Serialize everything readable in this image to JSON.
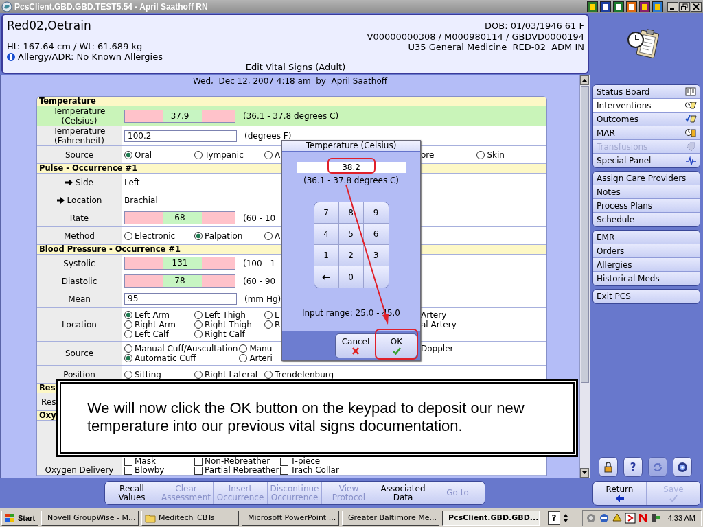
{
  "window": {
    "title": "PcsClient.GBD.GBD.TEST5.54 - April Saathoff RN"
  },
  "patient": {
    "name": "Red02,Oetrain",
    "dob": "DOB: 01/03/1946 61 F",
    "ids": "V00000000308 / M000980114 / GBDVD0000194",
    "location": "U35 General Medicine  RED-02  ADM IN",
    "measures": "Ht: 167.64 cm / Wt: 61.689 kg",
    "allergy": "Allergy/ADR: No Known Allergies",
    "screen_title": "Edit Vital Signs (Adult)"
  },
  "form": {
    "timestamp": "Wed,  Dec 12, 2007 4:18 am  by  April Saathoff",
    "sections": [
      {
        "title": "Temperature",
        "rows": [
          {
            "kind": "range",
            "label": "Temperature (Celsius)",
            "value": "37.9",
            "note": "(36.1 - 37.8 degrees C)",
            "highlighted": true
          },
          {
            "kind": "input",
            "label": "Temperature (Fahrenheit)",
            "value": "100.2",
            "note": "(degrees F)",
            "highlighted": false
          },
          {
            "kind": "choices",
            "label": "Source",
            "highlighted": false,
            "columns": [
              [
                {
                  "kind": "radio",
                  "label": "Oral",
                  "selected": true
                }
              ],
              [
                {
                  "kind": "radio",
                  "label": "Tympanic",
                  "selected": false
                }
              ],
              [
                {
                  "kind": "radio",
                  "label": "A",
                  "selected": false
                }
              ]
            ],
            "after": [
              [
                {
                  "kind": "fragment",
                  "label": "ore"
                },
                {
                  "kind": "radio",
                  "label": "Skin",
                  "selected": false
                }
              ]
            ]
          }
        ]
      },
      {
        "title": "Pulse - Occurrence #1",
        "rows": [
          {
            "kind": "detail",
            "label": "Side",
            "value": "Left",
            "highlighted": false
          },
          {
            "kind": "detail",
            "label": "Location",
            "value": "Brachial",
            "highlighted": false
          },
          {
            "kind": "range",
            "label": "Rate",
            "value": "68",
            "note": "(60 - 10",
            "highlighted": false
          },
          {
            "kind": "choices",
            "label": "Method",
            "highlighted": false,
            "columns": [
              [
                {
                  "kind": "radio",
                  "label": "Electronic",
                  "selected": false
                }
              ],
              [
                {
                  "kind": "radio",
                  "label": "Palpation",
                  "selected": true
                }
              ],
              [
                {
                  "kind": "radio",
                  "label": "A",
                  "selected": false
                }
              ]
            ]
          }
        ]
      },
      {
        "title": "Blood Pressure - Occurrence #1",
        "rows": [
          {
            "kind": "range",
            "label": "Systolic",
            "value": "131",
            "note": "(100 - 1",
            "highlighted": false
          },
          {
            "kind": "range",
            "label": "Diastolic",
            "value": "78",
            "note": "(60 - 90",
            "highlighted": false
          },
          {
            "kind": "input",
            "label": "Mean",
            "value": "95",
            "note": "(mm Hg)",
            "highlighted": false
          },
          {
            "kind": "choices",
            "label": "Location",
            "highlighted": false,
            "columns": [
              [
                {
                  "kind": "radio",
                  "label": "Left Arm",
                  "selected": true
                },
                {
                  "kind": "radio",
                  "label": "Right Arm",
                  "selected": false
                },
                {
                  "kind": "radio",
                  "label": "Left Calf",
                  "selected": false
                }
              ],
              [
                {
                  "kind": "radio",
                  "label": "Left Thigh",
                  "selected": false
                },
                {
                  "kind": "radio",
                  "label": "Right Thigh",
                  "selected": false
                },
                {
                  "kind": "radio",
                  "label": "Right Calf",
                  "selected": false
                }
              ],
              [
                {
                  "kind": "radio",
                  "label": "L",
                  "selected": false
                },
                {
                  "kind": "radio",
                  "label": "R",
                  "selected": false
                }
              ]
            ],
            "after": [
              [
                {
                  "kind": "fragment",
                  "label": "Artery"
                }
              ],
              [
                {
                  "kind": "fragment",
                  "label": "al Artery"
                }
              ]
            ]
          },
          {
            "kind": "choices",
            "label": "Source",
            "highlighted": false,
            "columns": [
              [
                {
                  "kind": "radio",
                  "label": "Manual Cuff/Auscultation",
                  "selected": false
                },
                {
                  "kind": "radio",
                  "label": "Automatic Cuff",
                  "selected": true
                }
              ],
              [
                {
                  "kind": "radio",
                  "label": "Manu",
                  "selected": false
                },
                {
                  "kind": "radio",
                  "label": "Arteri",
                  "selected": false
                }
              ]
            ],
            "after": [
              [
                {
                  "kind": "fragment",
                  "label": "Doppler"
                }
              ]
            ]
          },
          {
            "kind": "choices",
            "label": "Position",
            "highlighted": false,
            "columns": [
              [
                {
                  "kind": "radio",
                  "label": "Sitting",
                  "selected": false
                }
              ],
              [
                {
                  "kind": "radio",
                  "label": "Right Lateral",
                  "selected": false
                }
              ],
              [
                {
                  "kind": "radio",
                  "label": "Trendelenburg",
                  "selected": false
                }
              ]
            ]
          }
        ]
      },
      {
        "title": "Res",
        "rows": [
          {
            "kind": "blank",
            "label": "Res",
            "highlighted": false
          }
        ]
      },
      {
        "title": "Oxy",
        "rows": [
          {
            "kind": "checks",
            "label": "Oxygen Delivery",
            "highlighted": false,
            "columns": [
              [
                {
                  "kind": "check",
                  "label": "Mask",
                  "selected": false
                },
                {
                  "kind": "check",
                  "label": "Blowby",
                  "selected": false
                }
              ],
              [
                {
                  "kind": "check",
                  "label": "Non-Rebreather",
                  "selected": false
                },
                {
                  "kind": "check",
                  "label": "Partial Rebreather",
                  "selected": false
                }
              ],
              [
                {
                  "kind": "check",
                  "label": "T-piece",
                  "selected": false
                },
                {
                  "kind": "check",
                  "label": "Trach Collar",
                  "selected": false
                }
              ]
            ]
          }
        ]
      }
    ]
  },
  "keypad_dialog": {
    "title": "Temperature (Celsius)",
    "value": "38.2",
    "range": "(36.1 - 37.8 degrees C)",
    "keys": [
      "7",
      "8",
      "9",
      "4",
      "5",
      "6",
      "1",
      "2",
      "3",
      "←",
      "0",
      "."
    ],
    "input_range": "Input range: 25.0 - 45.0",
    "buttons": [
      {
        "kind": "cancel",
        "label": "Cancel"
      },
      {
        "kind": "ok",
        "label": "OK"
      }
    ]
  },
  "callout": {
    "text": "We will now click the OK button on the keypad to deposit our new temperature into our previous vital signs documentation."
  },
  "sidebar": {
    "groups": [
      {
        "items": [
          {
            "label": "Status Board",
            "selected": false,
            "disabled": false
          },
          {
            "label": "Interventions",
            "selected": true,
            "disabled": false
          },
          {
            "label": "Outcomes",
            "selected": false,
            "disabled": false
          },
          {
            "label": "MAR",
            "selected": false,
            "disabled": false
          },
          {
            "label": "Transfusions",
            "selected": false,
            "disabled": true
          },
          {
            "label": "Special Panel",
            "selected": false,
            "disabled": false
          }
        ]
      },
      {
        "items": [
          {
            "label": "Assign Care Providers",
            "selected": false,
            "disabled": false
          },
          {
            "label": "Notes",
            "selected": false,
            "disabled": false
          },
          {
            "label": "Process Plans",
            "selected": false,
            "disabled": false
          },
          {
            "label": "Schedule",
            "selected": false,
            "disabled": false
          }
        ]
      },
      {
        "items": [
          {
            "label": "EMR",
            "selected": false,
            "disabled": false
          },
          {
            "label": "Orders",
            "selected": false,
            "disabled": false
          },
          {
            "label": "Allergies",
            "selected": false,
            "disabled": false
          },
          {
            "label": "Historical Meds",
            "selected": false,
            "disabled": false
          }
        ]
      },
      {
        "items": [
          {
            "label": "Exit PCS",
            "selected": false,
            "disabled": false
          }
        ]
      }
    ]
  },
  "tools": [
    {
      "kind": "lock",
      "disabled": false
    },
    {
      "kind": "help",
      "label": "?",
      "disabled": false
    },
    {
      "kind": "refresh",
      "disabled": true
    },
    {
      "kind": "globe",
      "disabled": false
    }
  ],
  "toolbar": {
    "buttons": [
      {
        "label": "Recall Values",
        "disabled": false
      },
      {
        "label": "Clear Assessment",
        "disabled": true
      },
      {
        "label": "Insert Occurrence",
        "disabled": true
      },
      {
        "label": "Discontinue Occurrence",
        "disabled": true
      },
      {
        "label": "View Protocol",
        "disabled": true
      },
      {
        "label": "Associated Data",
        "disabled": false
      },
      {
        "label": "Go to",
        "disabled": true
      }
    ]
  },
  "actions": [
    {
      "kind": "return",
      "label": "Return",
      "disabled": false
    },
    {
      "kind": "save",
      "label": "Save",
      "disabled": true
    }
  ],
  "taskbar": {
    "start": "Start",
    "tasks": [
      {
        "kind": "mail",
        "label": "Novell GroupWise - M...",
        "selected": false
      },
      {
        "kind": "folder",
        "label": "Meditech_CBTs",
        "selected": false
      },
      {
        "kind": "slides",
        "label": "Microsoft PowerPoint ...",
        "selected": false
      },
      {
        "kind": "diamond",
        "label": "Greater Baltimore Me...",
        "selected": false
      },
      {
        "kind": "app",
        "label": "PcsClient.GBD.GBD....",
        "selected": true
      }
    ],
    "help": "?",
    "clock": "4:33 AM"
  }
}
